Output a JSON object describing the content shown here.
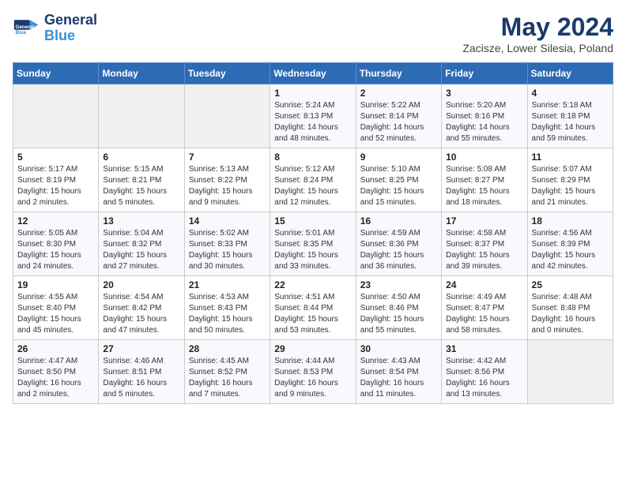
{
  "header": {
    "logo_line1": "General",
    "logo_line2": "Blue",
    "month_title": "May 2024",
    "subtitle": "Zacisze, Lower Silesia, Poland"
  },
  "days_of_week": [
    "Sunday",
    "Monday",
    "Tuesday",
    "Wednesday",
    "Thursday",
    "Friday",
    "Saturday"
  ],
  "weeks": [
    [
      {
        "day": "",
        "info": ""
      },
      {
        "day": "",
        "info": ""
      },
      {
        "day": "",
        "info": ""
      },
      {
        "day": "1",
        "info": "Sunrise: 5:24 AM\nSunset: 8:13 PM\nDaylight: 14 hours\nand 48 minutes."
      },
      {
        "day": "2",
        "info": "Sunrise: 5:22 AM\nSunset: 8:14 PM\nDaylight: 14 hours\nand 52 minutes."
      },
      {
        "day": "3",
        "info": "Sunrise: 5:20 AM\nSunset: 8:16 PM\nDaylight: 14 hours\nand 55 minutes."
      },
      {
        "day": "4",
        "info": "Sunrise: 5:18 AM\nSunset: 8:18 PM\nDaylight: 14 hours\nand 59 minutes."
      }
    ],
    [
      {
        "day": "5",
        "info": "Sunrise: 5:17 AM\nSunset: 8:19 PM\nDaylight: 15 hours\nand 2 minutes."
      },
      {
        "day": "6",
        "info": "Sunrise: 5:15 AM\nSunset: 8:21 PM\nDaylight: 15 hours\nand 5 minutes."
      },
      {
        "day": "7",
        "info": "Sunrise: 5:13 AM\nSunset: 8:22 PM\nDaylight: 15 hours\nand 9 minutes."
      },
      {
        "day": "8",
        "info": "Sunrise: 5:12 AM\nSunset: 8:24 PM\nDaylight: 15 hours\nand 12 minutes."
      },
      {
        "day": "9",
        "info": "Sunrise: 5:10 AM\nSunset: 8:25 PM\nDaylight: 15 hours\nand 15 minutes."
      },
      {
        "day": "10",
        "info": "Sunrise: 5:08 AM\nSunset: 8:27 PM\nDaylight: 15 hours\nand 18 minutes."
      },
      {
        "day": "11",
        "info": "Sunrise: 5:07 AM\nSunset: 8:29 PM\nDaylight: 15 hours\nand 21 minutes."
      }
    ],
    [
      {
        "day": "12",
        "info": "Sunrise: 5:05 AM\nSunset: 8:30 PM\nDaylight: 15 hours\nand 24 minutes."
      },
      {
        "day": "13",
        "info": "Sunrise: 5:04 AM\nSunset: 8:32 PM\nDaylight: 15 hours\nand 27 minutes."
      },
      {
        "day": "14",
        "info": "Sunrise: 5:02 AM\nSunset: 8:33 PM\nDaylight: 15 hours\nand 30 minutes."
      },
      {
        "day": "15",
        "info": "Sunrise: 5:01 AM\nSunset: 8:35 PM\nDaylight: 15 hours\nand 33 minutes."
      },
      {
        "day": "16",
        "info": "Sunrise: 4:59 AM\nSunset: 8:36 PM\nDaylight: 15 hours\nand 36 minutes."
      },
      {
        "day": "17",
        "info": "Sunrise: 4:58 AM\nSunset: 8:37 PM\nDaylight: 15 hours\nand 39 minutes."
      },
      {
        "day": "18",
        "info": "Sunrise: 4:56 AM\nSunset: 8:39 PM\nDaylight: 15 hours\nand 42 minutes."
      }
    ],
    [
      {
        "day": "19",
        "info": "Sunrise: 4:55 AM\nSunset: 8:40 PM\nDaylight: 15 hours\nand 45 minutes."
      },
      {
        "day": "20",
        "info": "Sunrise: 4:54 AM\nSunset: 8:42 PM\nDaylight: 15 hours\nand 47 minutes."
      },
      {
        "day": "21",
        "info": "Sunrise: 4:53 AM\nSunset: 8:43 PM\nDaylight: 15 hours\nand 50 minutes."
      },
      {
        "day": "22",
        "info": "Sunrise: 4:51 AM\nSunset: 8:44 PM\nDaylight: 15 hours\nand 53 minutes."
      },
      {
        "day": "23",
        "info": "Sunrise: 4:50 AM\nSunset: 8:46 PM\nDaylight: 15 hours\nand 55 minutes."
      },
      {
        "day": "24",
        "info": "Sunrise: 4:49 AM\nSunset: 8:47 PM\nDaylight: 15 hours\nand 58 minutes."
      },
      {
        "day": "25",
        "info": "Sunrise: 4:48 AM\nSunset: 8:48 PM\nDaylight: 16 hours\nand 0 minutes."
      }
    ],
    [
      {
        "day": "26",
        "info": "Sunrise: 4:47 AM\nSunset: 8:50 PM\nDaylight: 16 hours\nand 2 minutes."
      },
      {
        "day": "27",
        "info": "Sunrise: 4:46 AM\nSunset: 8:51 PM\nDaylight: 16 hours\nand 5 minutes."
      },
      {
        "day": "28",
        "info": "Sunrise: 4:45 AM\nSunset: 8:52 PM\nDaylight: 16 hours\nand 7 minutes."
      },
      {
        "day": "29",
        "info": "Sunrise: 4:44 AM\nSunset: 8:53 PM\nDaylight: 16 hours\nand 9 minutes."
      },
      {
        "day": "30",
        "info": "Sunrise: 4:43 AM\nSunset: 8:54 PM\nDaylight: 16 hours\nand 11 minutes."
      },
      {
        "day": "31",
        "info": "Sunrise: 4:42 AM\nSunset: 8:56 PM\nDaylight: 16 hours\nand 13 minutes."
      },
      {
        "day": "",
        "info": ""
      }
    ]
  ]
}
